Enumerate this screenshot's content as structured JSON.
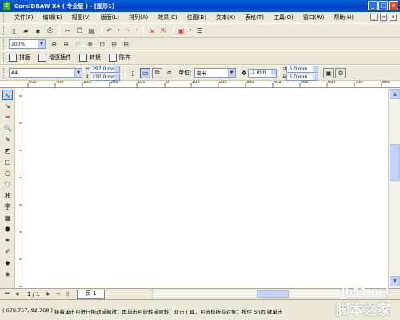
{
  "window": {
    "title": "CorelDRAW X4 ( 专业版 ) - [图形1]",
    "app_icon": "coreldraw-logo"
  },
  "menu": {
    "items": [
      "文件(F)",
      "编辑(E)",
      "视图(V)",
      "版面(L)",
      "排列(A)",
      "效果(C)",
      "位图(B)",
      "文本(X)",
      "表格(T)",
      "工具(O)",
      "窗口(W)",
      "帮助(H)"
    ]
  },
  "zoom": {
    "value": "100%"
  },
  "plugins": {
    "items": [
      "排版",
      "增强插件",
      "转换",
      "陈齐"
    ]
  },
  "property_bar": {
    "paper_size": "A4",
    "width": "297.0 mm",
    "height": "210.0 mm",
    "units_label": "单位:",
    "units_value": "毫米",
    "nudge": ".1 mm",
    "dup_x": "5.0 mm",
    "dup_y": "5.0 mm"
  },
  "ruler": {
    "labels": [
      "500",
      "400",
      "300",
      "200",
      "100",
      "0",
      "100",
      "200",
      "300",
      "400",
      "500",
      "600",
      "700",
      "800"
    ]
  },
  "page_nav": {
    "page_count": "1 / 1",
    "page_tab": "页 1"
  },
  "status": {
    "coords": "( 678.757, 92.768 )",
    "hint": "接着单击可进行拖动或缩放；再单击可旋转或倾斜；双击工具，可选择所有对象；按住 Shift 键单击"
  },
  "watermark": {
    "line1": "jb51.net",
    "line2": "脚本之家"
  },
  "colors": {
    "titlebar": "#0a52d0",
    "chrome": "#ece9d8",
    "canvas": "#ffffff",
    "scroll": "#c3d3fd"
  }
}
